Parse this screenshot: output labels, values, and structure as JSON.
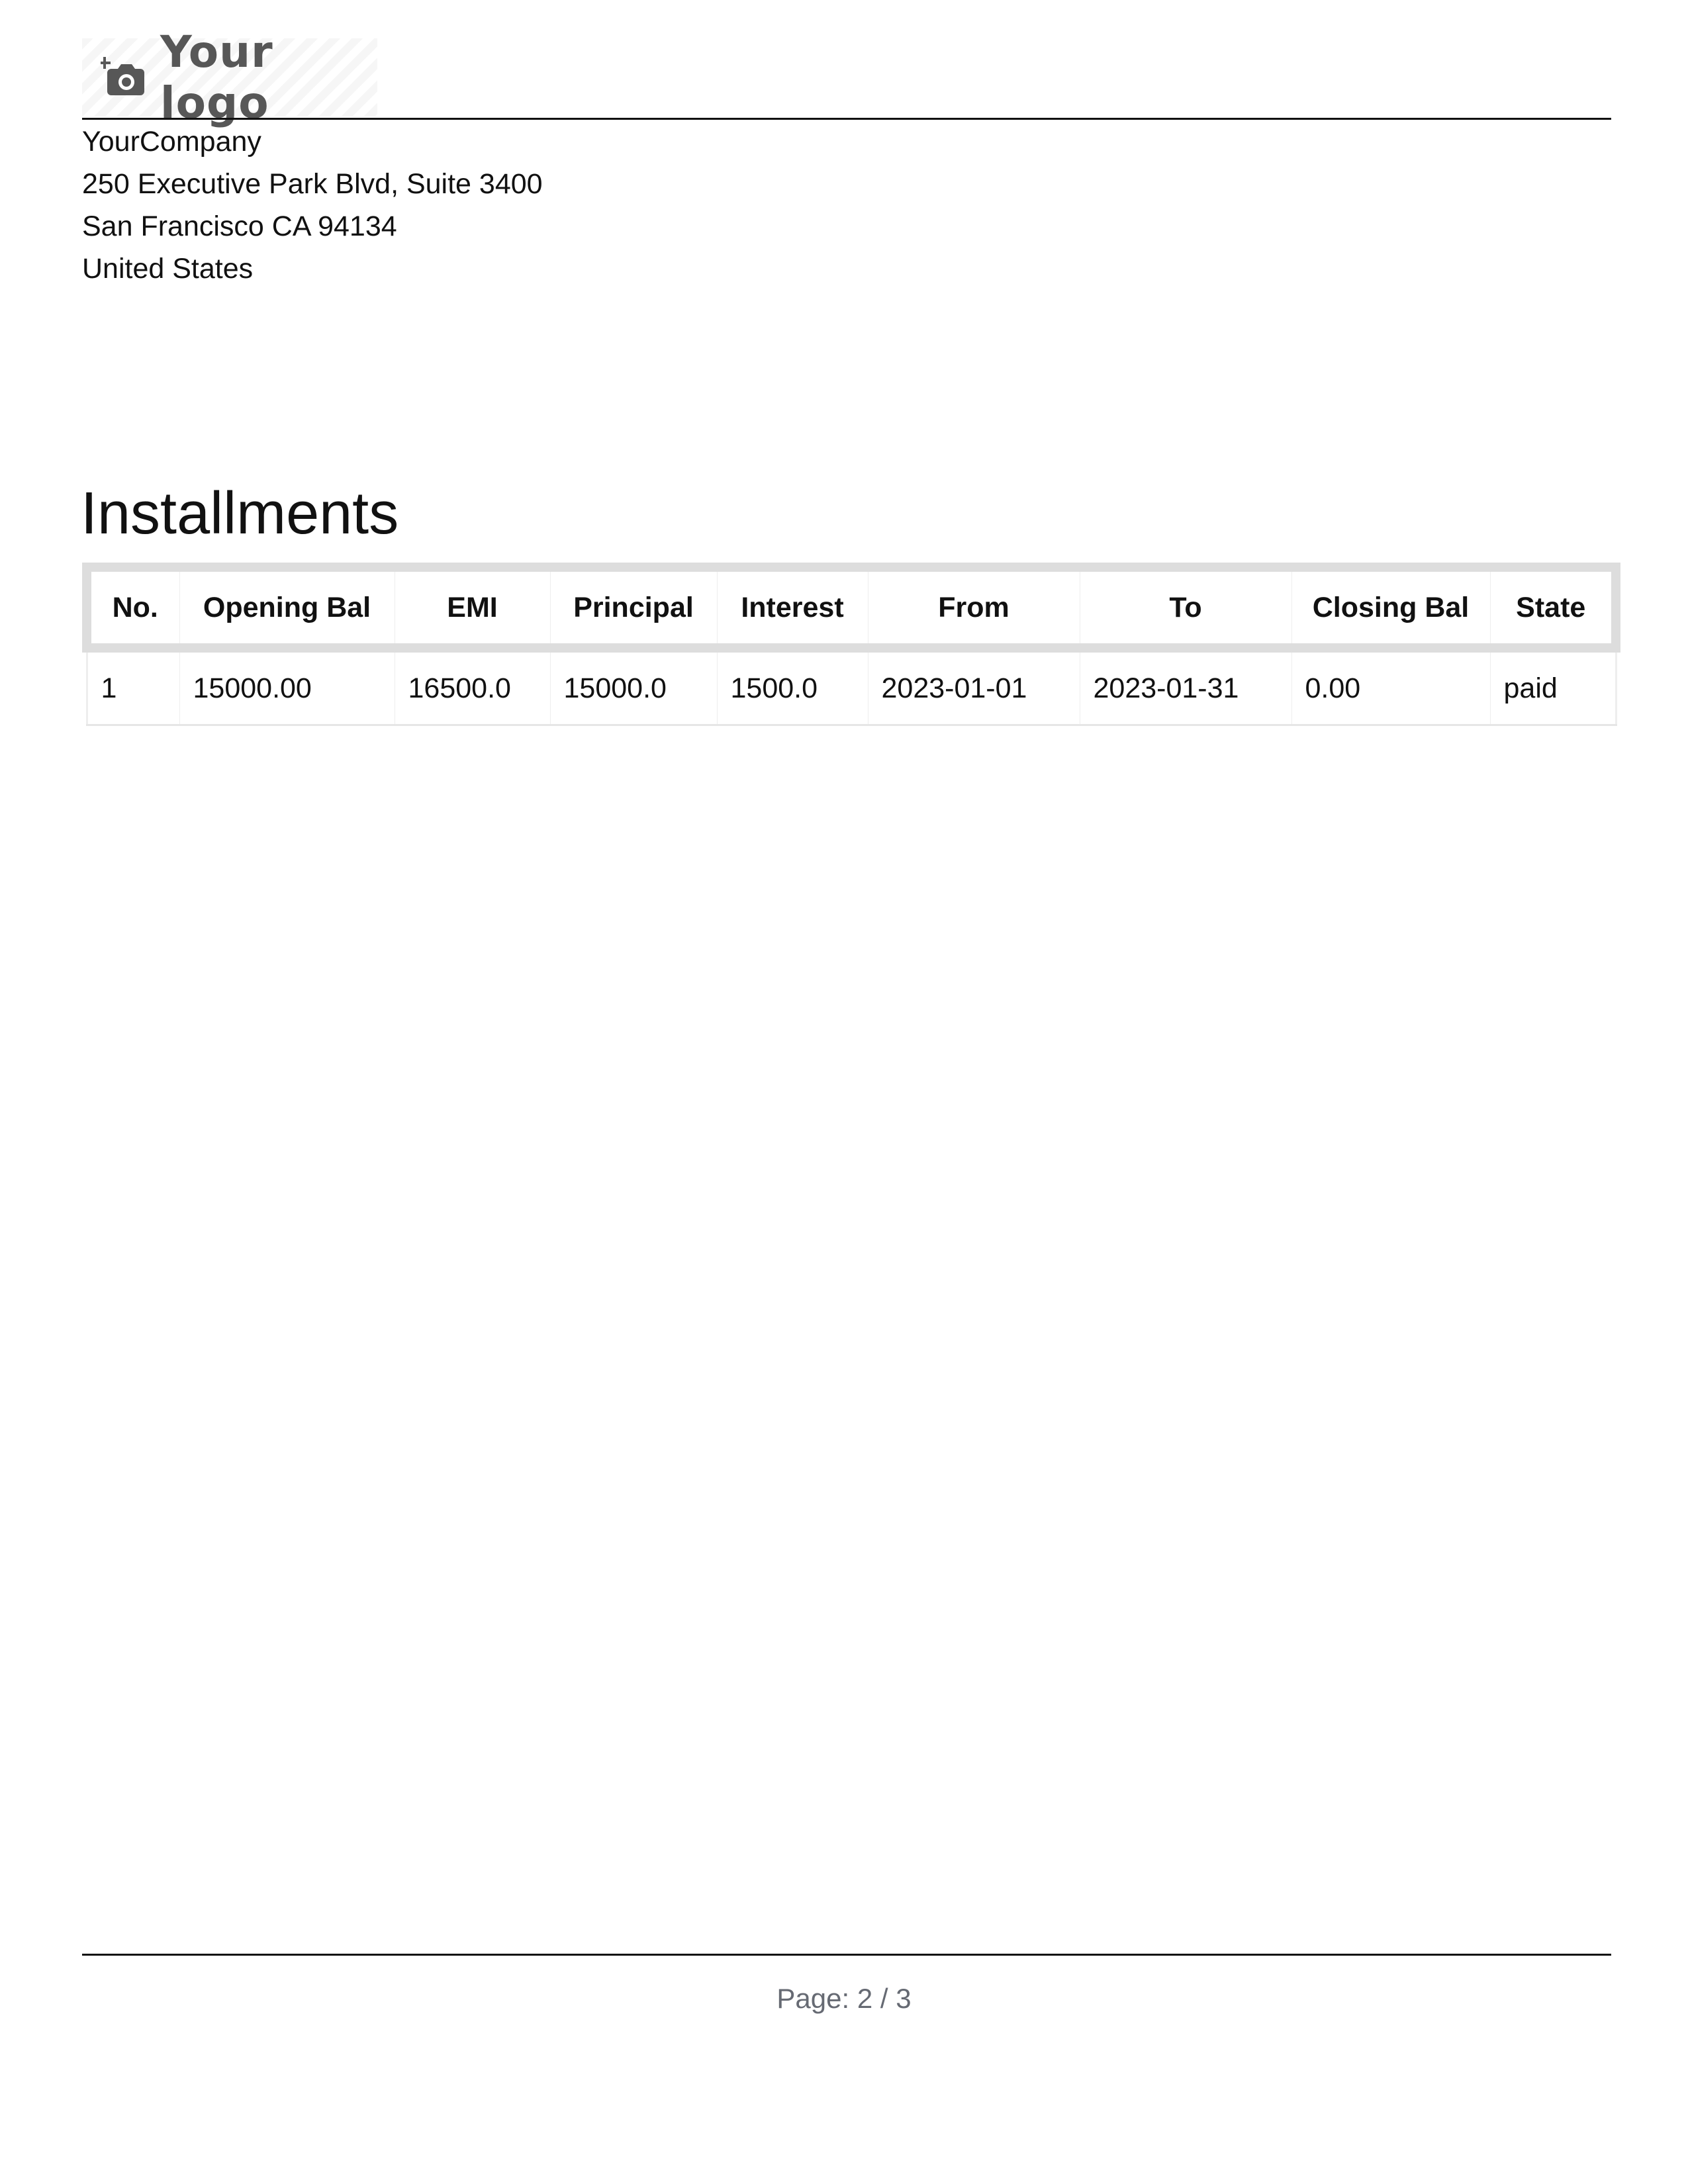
{
  "header": {
    "logo_text": "Your logo",
    "logo_icon": "camera-plus-icon"
  },
  "company": {
    "name": "YourCompany",
    "address_line1": "250 Executive Park Blvd, Suite 3400",
    "address_line2": "San Francisco CA 94134",
    "country": "United States"
  },
  "title": "Installments",
  "table": {
    "columns": [
      "No.",
      "Opening Bal",
      "EMI",
      "Principal",
      "Interest",
      "From",
      "To",
      "Closing Bal",
      "State"
    ],
    "rows": [
      [
        "1",
        "15000.00",
        "16500.0",
        "15000.0",
        "1500.0",
        "2023-01-01",
        "2023-01-31",
        "0.00",
        "paid"
      ]
    ]
  },
  "footer": {
    "page_label": "Page: 2 / 3"
  },
  "colors": {
    "text": "#111111",
    "logo_gray": "#575757",
    "table_border": "#dddddd",
    "footer_text": "#666a73"
  }
}
